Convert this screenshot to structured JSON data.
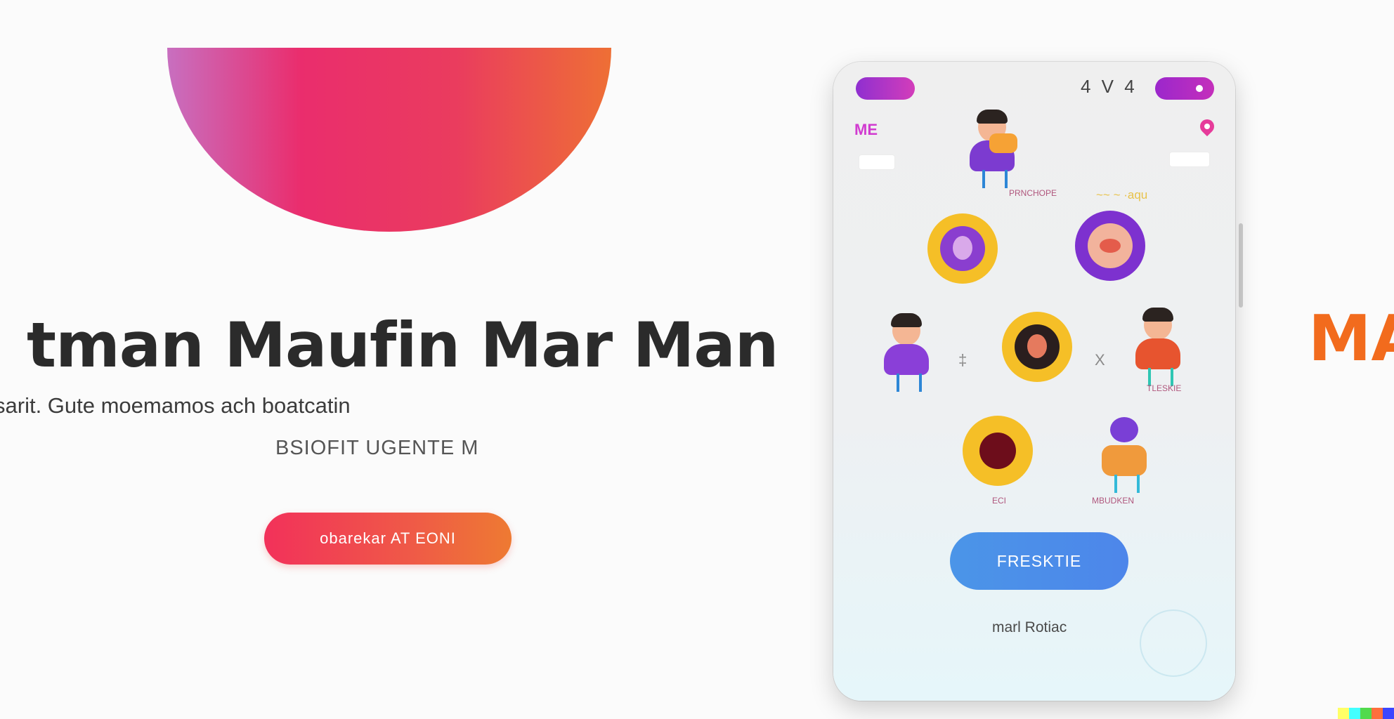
{
  "hero": {
    "headline": "tman Maufin Mar Man",
    "tagline": "sarit. Gute moemamos ach boatcatin",
    "subline": "BSIOFIT UGENTE M",
    "cta_label": "obarekar AT EONI",
    "edge_logo": "MA"
  },
  "colors": {
    "hero_gradient": [
      "#c86fc0",
      "#ea2d6d",
      "#ee6f35"
    ],
    "cta_gradient": [
      "#f2315a",
      "#ee7a32"
    ],
    "phone_action": "#4b8fe8",
    "avatar_ring": "#f5bf27",
    "avatar_purple": "#7d31cf",
    "brand_orange": "#f26b1d"
  },
  "phone": {
    "status_text": "4 V 4",
    "corner_mark": "ME",
    "wave_note": "~~ ~ ·aqu",
    "avatars": [
      {
        "id": "center-figure",
        "label": "PRNCHOPE",
        "icon": "person-figure-icon"
      },
      {
        "id": "ring-yellow-left",
        "label": "",
        "icon": "avatar-circle-icon"
      },
      {
        "id": "ring-purple-right",
        "label": "",
        "icon": "avatar-circle-icon"
      },
      {
        "id": "figure-left",
        "label": "",
        "icon": "person-figure-icon"
      },
      {
        "id": "ring-center",
        "label": "",
        "icon": "avatar-circle-icon"
      },
      {
        "id": "figure-right",
        "label": "TLESKIE",
        "icon": "person-figure-icon"
      },
      {
        "id": "ring-maroon",
        "label": "ECI",
        "icon": "avatar-circle-icon"
      },
      {
        "id": "figure-bottom",
        "label": "MBUDKEN",
        "icon": "person-figure-icon"
      }
    ],
    "connectors": [
      "‡",
      "X"
    ],
    "primary_action": "FRESKTIE",
    "footer_link": "marl Rotiac"
  }
}
